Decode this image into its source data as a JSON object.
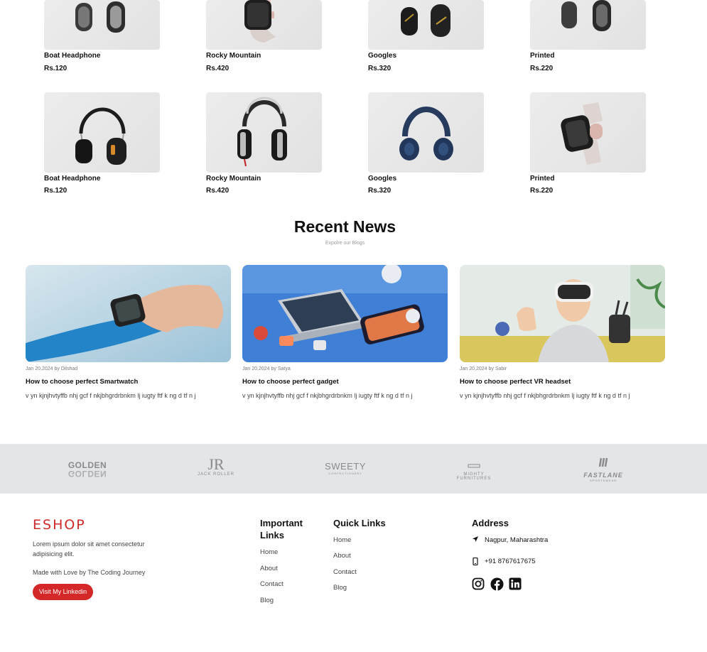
{
  "products": [
    {
      "name": "Boat Headphone",
      "price": "Rs.120",
      "image": "silver-headphone"
    },
    {
      "name": "Rocky Mountain",
      "price": "Rs.420",
      "image": "pink-smartwatch"
    },
    {
      "name": "Googles",
      "price": "Rs.320",
      "image": "gold-headphone"
    },
    {
      "name": "Printed",
      "price": "Rs.220",
      "image": "grey-headphone"
    },
    {
      "name": "Boat Headphone",
      "price": "Rs.120",
      "image": "black-headphone"
    },
    {
      "name": "Rocky Mountain",
      "price": "Rs.420",
      "image": "steel-headphone"
    },
    {
      "name": "Googles",
      "price": "Rs.320",
      "image": "navy-headphone"
    },
    {
      "name": "Printed",
      "price": "Rs.220",
      "image": "pink-smartwatch"
    }
  ],
  "news": {
    "title": "Recent News",
    "subtitle": "Expolre our Blogs",
    "posts": [
      {
        "meta": "Jan 20,2024 by Dilshad",
        "title": "How to choose perfect Smartwatch",
        "desc": "v yn kjnjhvtyffb nhj gcf f nkjbhgrdrbnkm lj iugty ftf k ng d tf n j",
        "image": "smartwatch-photo"
      },
      {
        "meta": "Jan 20,2024 by Satya",
        "title": "How to choose perfect gadget",
        "desc": "v yn kjnjhvtyffb nhj gcf f nkjbhgrdrbnkm lj iugty ftf k ng d tf n j",
        "image": "gadgets-photo"
      },
      {
        "meta": "Jan 20,2024 by Sabir",
        "title": "How to choose perfect VR headset",
        "desc": "v yn kjnjhvtyffb nhj gcf f nkjbhgrdrbnkm lj iugty ftf k ng d tf n j",
        "image": "vr-photo"
      }
    ]
  },
  "brands": {
    "golden": "GOLDEN",
    "jr": "JR",
    "jr_sub": "JACK ROLLER",
    "sweety": "SWEETY",
    "sweety_sub": "CONFECTIONERY",
    "mighty": "MIGHTY",
    "mighty_sub": "FURNITURES",
    "fastlane": "FASTLANE",
    "fastlane_sub": "SPORTSWEAR"
  },
  "footer": {
    "logo": "ESHOP",
    "about": "Lorem ipsum dolor sit amet consectetur adipisicing elit.",
    "made_with": "Made with Love by The Coding Journey",
    "button": "Visit My Linkedin",
    "important_title": "Important Links",
    "important_links": [
      "Home",
      "About",
      "Contact",
      "Blog"
    ],
    "quick_title": "Quick Links",
    "quick_links": [
      "Home",
      "About",
      "Contact",
      "Blog"
    ],
    "address_title": "Address",
    "location": "Nagpur, Maharashtra",
    "phone": "+91 8767617675",
    "social": [
      "instagram-icon",
      "facebook-icon",
      "linkedin-icon"
    ],
    "accent_color": "#d42828"
  }
}
